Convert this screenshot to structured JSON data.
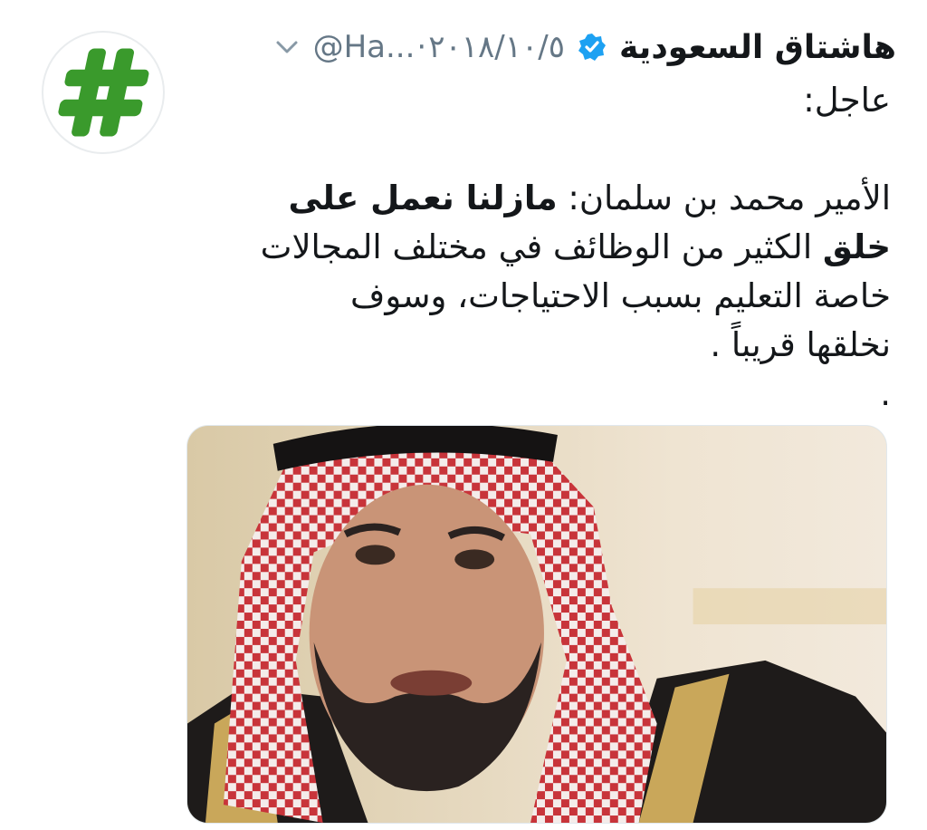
{
  "tweet": {
    "display_name": "هاشتاق السعودية",
    "handle": "@Ha...",
    "separator": "·",
    "date": "٢٠١٨/١٠/٥",
    "body": {
      "line1": "عاجل:",
      "line2_normal": "الأمير محمد بن سلمان: ",
      "line2_bold": "مازلنا نعمل على",
      "line3_bold": "خلق",
      "line3_normal": " الكثير من الوظائف في مختلف المجالات",
      "line4": "خاصة التعليم بسبب الاحتياجات، وسوف",
      "line5": "نخلقها قريباً .",
      "line6": "."
    },
    "icons": {
      "avatar": "hashtag-logo-icon",
      "verified": "verified-badge-icon",
      "caret": "chevron-down-icon"
    },
    "colors": {
      "text": "#14171a",
      "muted": "#657786",
      "verified": "#1da1f2",
      "logo_green": "#3a9a2c"
    }
  }
}
